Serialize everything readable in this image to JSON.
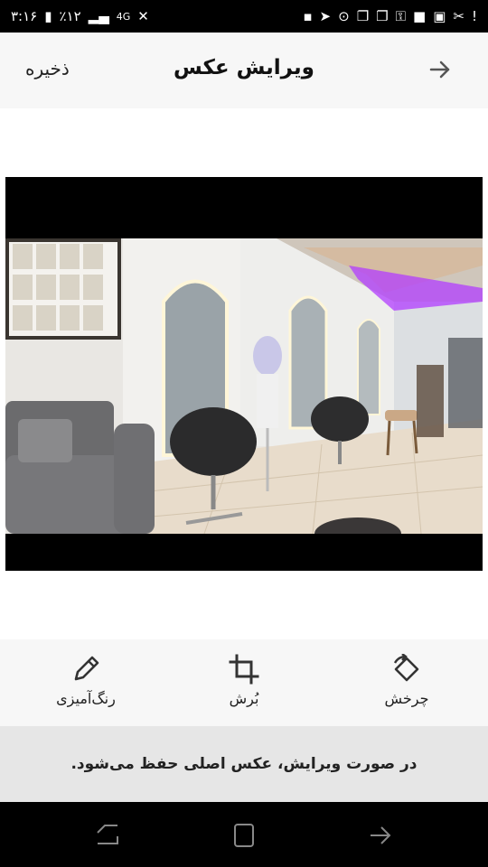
{
  "status_bar": {
    "time": "۳:۱۶",
    "battery": "٪۱۲",
    "network": "4G"
  },
  "app_bar": {
    "title": "ویرایش عکس",
    "save_label": "ذخیره",
    "back_icon": "arrow-right-icon"
  },
  "tools": [
    {
      "label": "رنگ‌آمیزی",
      "icon": "brush-icon"
    },
    {
      "label": "بُرش",
      "icon": "crop-icon"
    },
    {
      "label": "چرخش",
      "icon": "rotate-icon"
    }
  ],
  "notice": "در صورت ویرایش، عکس اصلی حفظ می‌شود.",
  "colors": {
    "bar_bg": "#f7f7f7",
    "notice_bg": "#e6e6e6",
    "accent_light": "#b23cff"
  }
}
